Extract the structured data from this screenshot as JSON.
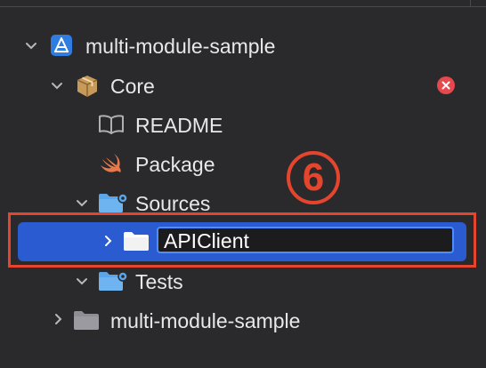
{
  "tree": {
    "project": {
      "label": "multi-module-sample"
    },
    "core": {
      "label": "Core",
      "error_icon": "error-x-icon"
    },
    "readme": {
      "label": "README"
    },
    "package": {
      "label": "Package"
    },
    "sources": {
      "label": "Sources"
    },
    "apiclient": {
      "label": "APIClient"
    },
    "tests": {
      "label": "Tests"
    },
    "folder2": {
      "label": "multi-module-sample"
    }
  },
  "annotation": {
    "step": "6"
  },
  "colors": {
    "background": "#2a2a2c",
    "selection": "#2b5bd1",
    "highlight_red": "#e5452c",
    "error_red": "#e5484d",
    "swift_orange": "#e8794a",
    "folder_blue": "#5aa6e8"
  }
}
